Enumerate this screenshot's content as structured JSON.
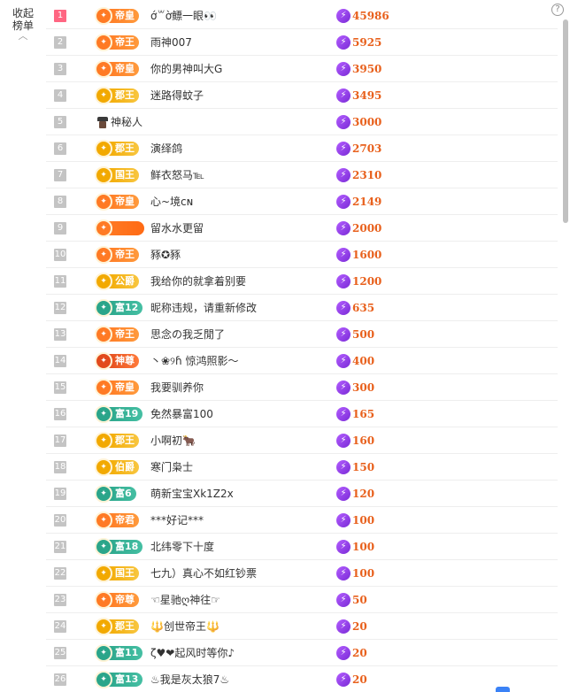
{
  "side": {
    "line1": "收起",
    "line2": "榜单",
    "arrow": "︿"
  },
  "help": "?",
  "colors": {
    "rank_top": "#ff6682",
    "score": "#e8601c",
    "bolt": "#8a3be6"
  },
  "rows": [
    {
      "rank": "1",
      "badge": "帝皇",
      "style": "b-huang",
      "name": "ớ꒳ờ鳔一眼👀",
      "score": "45986"
    },
    {
      "rank": "2",
      "badge": "帝王",
      "style": "b-wang",
      "name": "雨神007",
      "score": "5925"
    },
    {
      "rank": "3",
      "badge": "帝皇",
      "style": "b-huang",
      "name": "你的男神叫大G",
      "score": "3950"
    },
    {
      "rank": "4",
      "badge": "郡王",
      "style": "b-jun",
      "name": "迷路得蚊子",
      "score": "3495"
    },
    {
      "rank": "5",
      "badge": "",
      "style": "mystery",
      "name": "神秘人",
      "score": "3000"
    },
    {
      "rank": "6",
      "badge": "郡王",
      "style": "b-jun",
      "name": "演绎鸽",
      "score": "2703"
    },
    {
      "rank": "7",
      "badge": "国王",
      "style": "b-guowang",
      "name": "鲜衣怒马℡",
      "score": "2310"
    },
    {
      "rank": "8",
      "badge": "帝皇",
      "style": "b-huang",
      "name": "心~境ᴄɴ",
      "score": "2149"
    },
    {
      "rank": "9",
      "badge": "",
      "style": "b-blank",
      "name": "留水水更留",
      "score": "2000"
    },
    {
      "rank": "10",
      "badge": "帝王",
      "style": "b-wang",
      "name": "豩✪豩",
      "score": "1600"
    },
    {
      "rank": "11",
      "badge": "公爵",
      "style": "b-gong",
      "name": "我给你的就拿着别要",
      "score": "1200"
    },
    {
      "rank": "12",
      "badge": "富12",
      "style": "b-fu",
      "name": "昵称违规，请重新修改",
      "score": "635"
    },
    {
      "rank": "13",
      "badge": "帝王",
      "style": "b-wang",
      "name": "思念の我乏閒了",
      "score": "500"
    },
    {
      "rank": "14",
      "badge": "神尊",
      "style": "b-shen",
      "name": "丶❀୨ɦ 惊鸿照影～",
      "score": "400"
    },
    {
      "rank": "15",
      "badge": "帝皇",
      "style": "b-huang",
      "name": "我要驯养你",
      "score": "300"
    },
    {
      "rank": "16",
      "badge": "富19",
      "style": "b-fu",
      "name": "免然暴富100",
      "score": "165"
    },
    {
      "rank": "17",
      "badge": "郡王",
      "style": "b-jun",
      "name": "小啊初🐂",
      "score": "160"
    },
    {
      "rank": "18",
      "badge": "伯爵",
      "style": "b-bo",
      "name": "寒门枭士",
      "score": "150"
    },
    {
      "rank": "19",
      "badge": "富6",
      "style": "b-fu",
      "name": "萌新宝宝Xk1Z2x",
      "score": "120"
    },
    {
      "rank": "20",
      "badge": "帝君",
      "style": "b-jun2",
      "name": "***好记***",
      "score": "100"
    },
    {
      "rank": "21",
      "badge": "富18",
      "style": "b-fu",
      "name": "北纬零下十度",
      "score": "100"
    },
    {
      "rank": "22",
      "badge": "国王",
      "style": "b-guowang",
      "name": "七九）真心不如红钞票",
      "score": "100"
    },
    {
      "rank": "23",
      "badge": "帝尊",
      "style": "b-zun",
      "name": "☜星驰ღ神往☞",
      "score": "50"
    },
    {
      "rank": "24",
      "badge": "郡王",
      "style": "b-jun",
      "name": "🔱创世帝王🔱",
      "score": "20"
    },
    {
      "rank": "25",
      "badge": "富11",
      "style": "b-fu",
      "name": "ζ♥❤起风时等你♪",
      "score": "20"
    },
    {
      "rank": "26",
      "badge": "富13",
      "style": "b-fu",
      "name": "♨我是灰太狼7♨",
      "score": "20"
    }
  ]
}
